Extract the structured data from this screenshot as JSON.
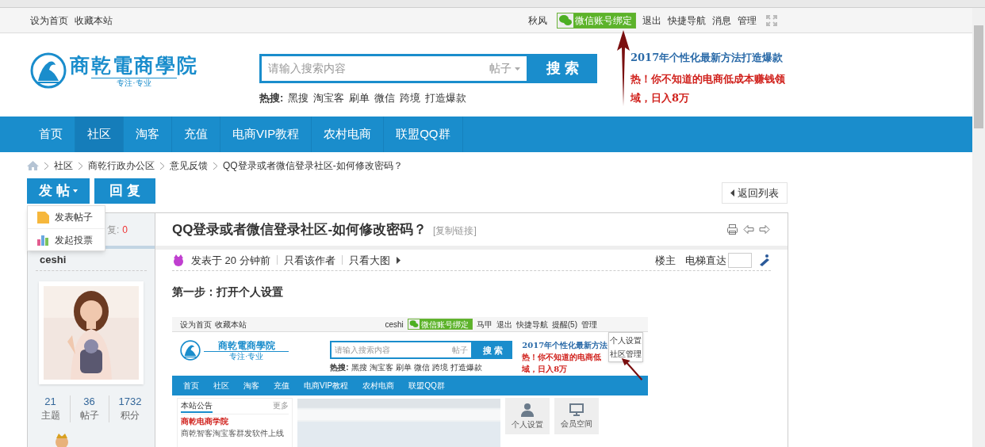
{
  "topbar": {
    "left_links": [
      "设为首页",
      "收藏本站"
    ],
    "user": "秋风",
    "wechat_button": "微信账号绑定",
    "links": [
      "退出",
      "快捷导航",
      "消息",
      "管理"
    ]
  },
  "header": {
    "logo": {
      "name": "商乾電商學院",
      "tagline": "专注·专业"
    },
    "search": {
      "placeholder": "请输入搜索内容",
      "scope": "帖子",
      "button": "搜 索"
    },
    "hot_label": "热搜:",
    "hot_terms": [
      "黑搜",
      "淘宝客",
      "刷单",
      "微信",
      "跨境",
      "打造爆款"
    ],
    "promo": [
      {
        "kind": "title",
        "text": "2017年个性化最新方法打造爆款"
      },
      {
        "kind": "hot",
        "text": "热！你不知道的电商低成本赚钱领域，日入8万"
      }
    ]
  },
  "nav": {
    "items": [
      {
        "label": "首页",
        "selected": false
      },
      {
        "label": "社区",
        "selected": true
      },
      {
        "label": "淘客",
        "selected": false
      },
      {
        "label": "充值",
        "selected": false
      },
      {
        "label": "电商VIP教程",
        "selected": false
      },
      {
        "label": "农村电商",
        "selected": false
      },
      {
        "label": "联盟QQ群",
        "selected": false
      }
    ]
  },
  "breadcrumb": [
    "社区",
    "商乾行政办公区",
    "意见反馈",
    "QQ登录或者微信登录社区-如何修改密码？"
  ],
  "actions": {
    "post_button": "发 帖",
    "reply_button": "回 复",
    "back_button": "返回列表"
  },
  "post_menu": {
    "items": [
      {
        "kind": "post",
        "label": "发表帖子"
      },
      {
        "kind": "poll",
        "label": "发起投票"
      }
    ]
  },
  "thread": {
    "reply_label": "复:",
    "reply_count": "0",
    "title": "QQ登录或者微信登录社区-如何修改密码？",
    "copy_link": "[复制链接]"
  },
  "author": {
    "name": "ceshi",
    "stats": [
      {
        "value": "21",
        "label": "主题"
      },
      {
        "value": "36",
        "label": "帖子"
      },
      {
        "value": "1732",
        "label": "积分"
      }
    ]
  },
  "post_meta": {
    "posted": "发表于 20 分钟前",
    "links": [
      "只看该作者",
      "只看大图"
    ],
    "floor": "楼主",
    "jump_label": "电梯直达"
  },
  "post_body": {
    "step": "第一步：打开个人设置",
    "screenshot": {
      "left_links": [
        "设为首页",
        "收藏本站"
      ],
      "user": "ceshi",
      "wechat_button": "微信账号绑定",
      "links": [
        "马甲",
        "退出",
        "快捷导航",
        "提醒(5)",
        "管理"
      ],
      "dropdown": [
        "个人设置",
        "社区管理"
      ],
      "logo": {
        "name": "商乾電商學院",
        "tagline": "专注·专业"
      },
      "search": {
        "placeholder": "请输入搜索内容",
        "scope": "帖子",
        "button": "搜 索"
      },
      "hot_label": "热搜:",
      "hot_terms": [
        "黑搜",
        "淘宝客",
        "刷单",
        "微信",
        "跨境",
        "打造爆款"
      ],
      "promo": [
        {
          "kind": "title",
          "text": "2017年个性化最新方法"
        },
        {
          "kind": "hot",
          "text": "热！你不知道的电商低"
        },
        {
          "kind": "hot",
          "text": "域，日入8万"
        }
      ],
      "nav": [
        "首页",
        "社区",
        "淘客",
        "充值",
        "电商VIP教程",
        "农村电商",
        "联盟QQ群"
      ],
      "notice_title": "本站公告",
      "notice_more": "更多",
      "notices": [
        {
          "text": "商乾电商学院",
          "highlighted": true
        },
        {
          "text": "商乾智客淘宝客群发软件上线",
          "highlighted": false
        }
      ],
      "tiles": [
        {
          "kind": "person",
          "label": "个人设置"
        },
        {
          "kind": "monitor",
          "label": "会员空间"
        }
      ]
    }
  }
}
